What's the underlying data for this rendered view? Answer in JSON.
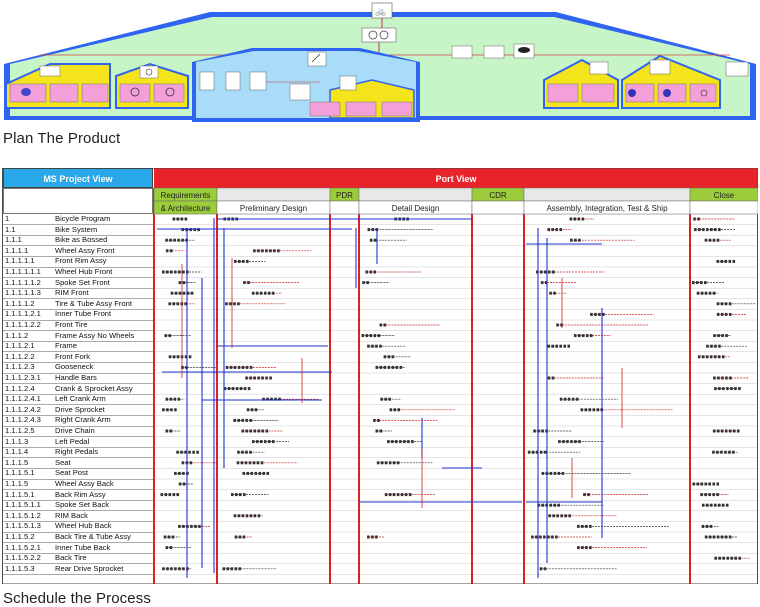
{
  "captions": {
    "plan": "Plan The Product",
    "schedule": "Schedule the Process"
  },
  "table": {
    "header": "MS Project View",
    "rows": [
      {
        "wbs": "1",
        "name": "Bicycle Program"
      },
      {
        "wbs": "1.1",
        "name": "Bike System"
      },
      {
        "wbs": "1.1.1",
        "name": "Bike as Bossed"
      },
      {
        "wbs": "1.1.1.1",
        "name": "Wheel Assy Front"
      },
      {
        "wbs": "1.1.1.1.1",
        "name": "Front Rim Assy"
      },
      {
        "wbs": "1.1.1.1.1.1",
        "name": "Wheel Hub Front"
      },
      {
        "wbs": "1.1.1.1.1.2",
        "name": "Spoke Set Front"
      },
      {
        "wbs": "1.1.1.1.1.3",
        "name": "RIM Front"
      },
      {
        "wbs": "1.1.1.1.2",
        "name": "Tire & Tube Assy Front"
      },
      {
        "wbs": "1.1.1.1.2.1",
        "name": "Inner Tube Front"
      },
      {
        "wbs": "1.1.1.1.2.2",
        "name": "Front Tire"
      },
      {
        "wbs": "1.1.1.2",
        "name": "Frame Assy No Wheels"
      },
      {
        "wbs": "1.1.1.2.1",
        "name": "Frame"
      },
      {
        "wbs": "1.1.1.2.2",
        "name": "Front Fork"
      },
      {
        "wbs": "1.1.1.2.3",
        "name": "Gooseneck"
      },
      {
        "wbs": "1.1.1.2.3.1",
        "name": "Handle Bars"
      },
      {
        "wbs": "1.1.1.2.4",
        "name": "Crank & Sprocket Assy"
      },
      {
        "wbs": "1.1.1.2.4.1",
        "name": "Left Crank Arm"
      },
      {
        "wbs": "1.1.1.2.4.2",
        "name": "Drive Sprocket"
      },
      {
        "wbs": "1.1.1.2.4.3",
        "name": "Right Crank Arm"
      },
      {
        "wbs": "1.1.1.2.5",
        "name": "Drive Chain"
      },
      {
        "wbs": "1.1.1.3",
        "name": "Left Pedal"
      },
      {
        "wbs": "1.1.1.4",
        "name": "Right Pedals"
      },
      {
        "wbs": "1.1.1.5",
        "name": "Seat"
      },
      {
        "wbs": "1.1.1.5.1",
        "name": "Seat Post"
      },
      {
        "wbs": "1.1.1.5",
        "name": "Wheel Assy Back"
      },
      {
        "wbs": "1.1.1.5.1",
        "name": "Back Rim Assy"
      },
      {
        "wbs": "1.1.1.5.1.1",
        "name": "Spoke Set Back"
      },
      {
        "wbs": "1.1.1.5.1.2",
        "name": "RIM Back"
      },
      {
        "wbs": "1.1.1.5.1.3",
        "name": "Wheel Hub Back"
      },
      {
        "wbs": "1.1.1.5.2",
        "name": "Back Tire & Tube Assy"
      },
      {
        "wbs": "1.1.1.5.2.1",
        "name": "Inner Tube Back"
      },
      {
        "wbs": "1.1.1.5.2.2",
        "name": "Back Tire"
      },
      {
        "wbs": "1.1.1.5.3",
        "name": "Rear Drive Sprocket"
      }
    ]
  },
  "port_view": {
    "header": "Port View",
    "phases": [
      {
        "label": "Requirements",
        "sub": "& Architecture",
        "green": true
      },
      {
        "label": "",
        "sub": "Preliminary Design",
        "green": false
      },
      {
        "label": "PDR",
        "sub": "",
        "green": true
      },
      {
        "label": "",
        "sub": "Detail Design",
        "green": false
      },
      {
        "label": "CDR",
        "sub": "",
        "green": true
      },
      {
        "label": "",
        "sub": "Assembly, Integration, Test & Ship",
        "green": false
      },
      {
        "label": "Close",
        "sub": "",
        "green": true
      }
    ]
  },
  "colors": {
    "header_blue": "#28a8e8",
    "header_red": "#e8232a",
    "phase_green": "#9ccc3c",
    "phase_line_red": "#e02020",
    "gantt_blue": "#2233cc",
    "gantt_red": "#cc2020",
    "tree_blue": "#2e64f0",
    "tree_green": "#c8f5c8",
    "tree_yellow": "#f4e41c",
    "tree_pink": "#f4a0d8",
    "tree_sky": "#a8dcf8"
  }
}
